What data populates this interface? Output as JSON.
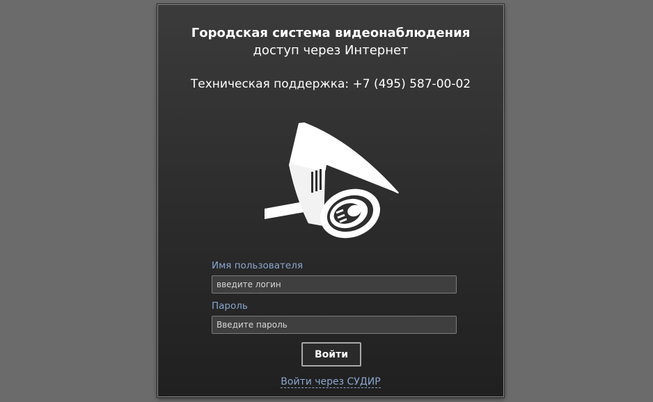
{
  "header": {
    "title": "Городская система видеонаблюдения",
    "subtitle": "доступ через Интернет",
    "support": "Техническая поддержка: +7 (495) 587-00-02"
  },
  "logo": {
    "icon": "surveillance-camera-icon",
    "color": "#ffffff"
  },
  "form": {
    "username_label": "Имя пользователя",
    "username_placeholder": "введите логин",
    "password_label": "Пароль",
    "password_placeholder": "Введите пароль",
    "submit_label": "Войти",
    "sso_link": "Войти через СУДИР"
  },
  "colors": {
    "background": "#6b6b6b",
    "panel": "#2e2e2e",
    "label": "#8aa6cf",
    "text": "#ffffff"
  }
}
